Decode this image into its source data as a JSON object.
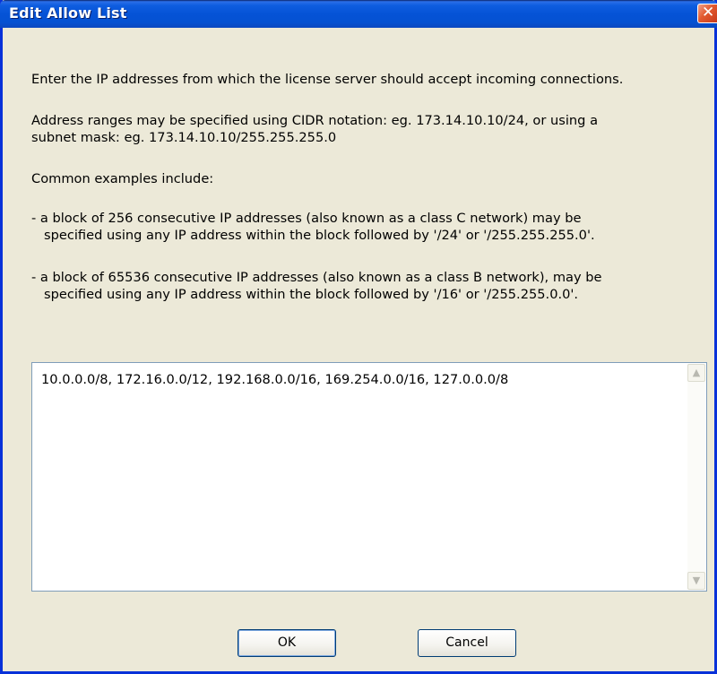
{
  "window": {
    "title": "Edit Allow List"
  },
  "description": {
    "line1": "Enter the IP addresses from which the license server should accept incoming connections.",
    "line2a": "Address ranges may be specified using CIDR notation: eg. 173.14.10.10/24, or using a",
    "line2b": "subnet mask: eg. 173.14.10.10/255.255.255.0",
    "line3": "Common examples include:",
    "ex1a": "- a block of 256 consecutive IP addresses (also known as a class C network) may be",
    "ex1b": "specified using any IP address within the block followed by '/24' or '/255.255.255.0'.",
    "ex2a": "- a block of 65536 consecutive IP addresses (also known as a class B network), may be",
    "ex2b": "specified using any IP address within the block followed by '/16' or '/255.255.0.0'."
  },
  "allow_list": {
    "value": "10.0.0.0/8, 172.16.0.0/12, 192.168.0.0/16, 169.254.0.0/16, 127.0.0.0/8"
  },
  "buttons": {
    "ok": "OK",
    "cancel": "Cancel"
  },
  "icons": {
    "close": "close-icon",
    "scroll_up": "scroll-up-arrow-icon",
    "scroll_down": "scroll-down-arrow-icon"
  },
  "colors": {
    "title_bar": "#0553d6",
    "dialog_bg": "#ece9d8",
    "close_button": "#e25a2f"
  }
}
